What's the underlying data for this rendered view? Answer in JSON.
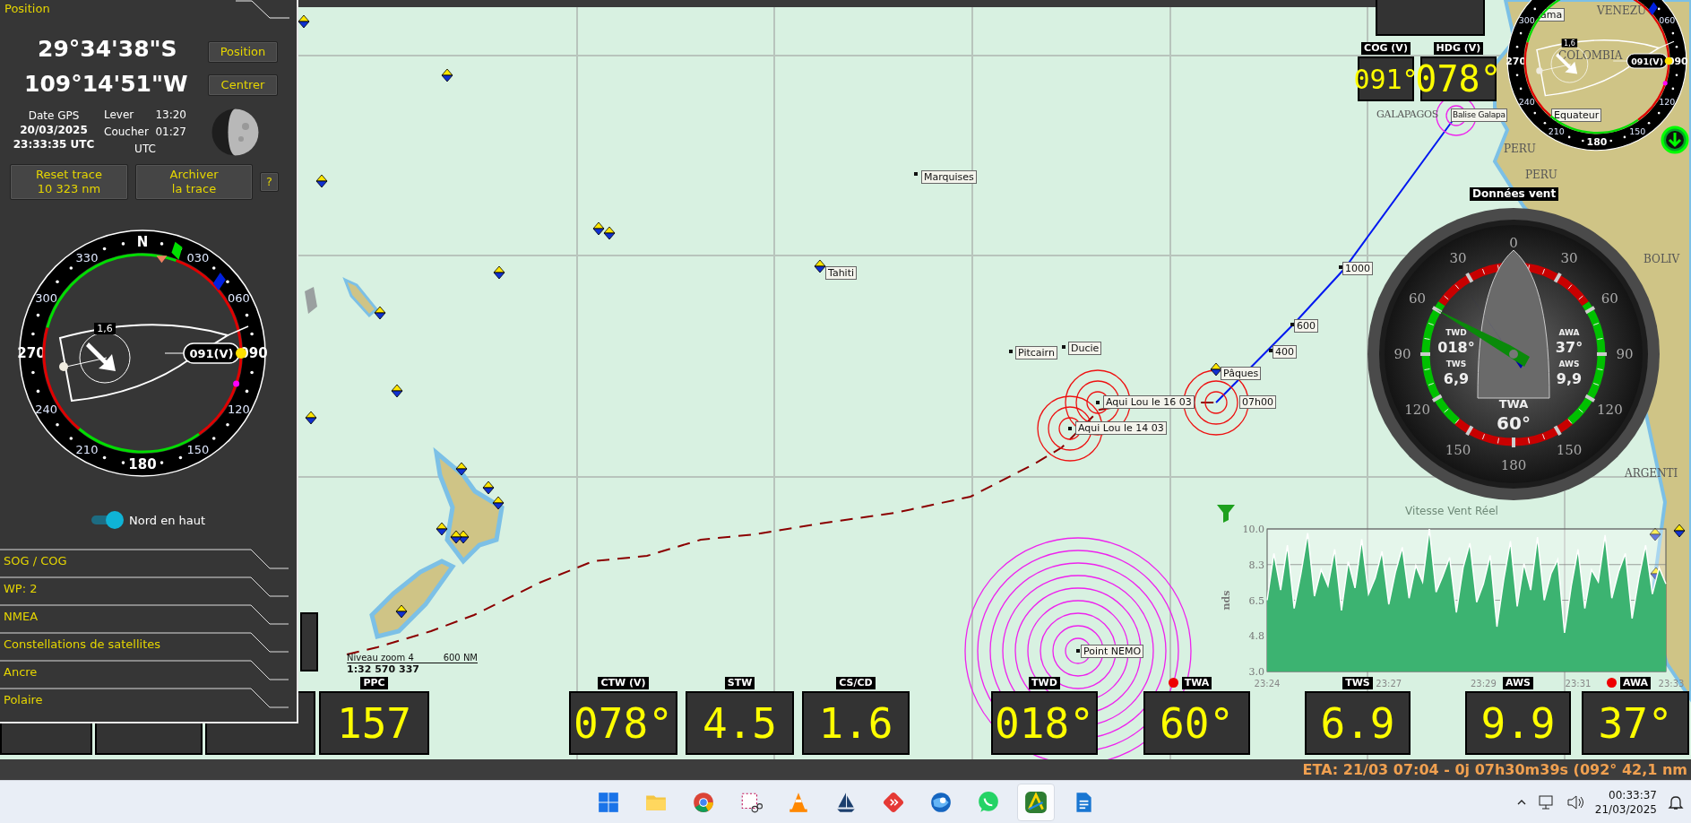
{
  "left_panel": {
    "title": "Position",
    "latitude": "29°34'38\"S",
    "longitude": "109°14'51\"W",
    "buttons": [
      "Position",
      "Centrer"
    ],
    "gps": {
      "label": "Date GPS",
      "date": "20/03/2025",
      "time": "23:33:35 UTC"
    },
    "moon": {
      "rise_label": "Lever",
      "rise": "13:20",
      "set_label": "Coucher",
      "set": "01:27",
      "zone": "UTC"
    },
    "trace_buttons": [
      {
        "label": "Reset trace",
        "detail": "10 323 nm"
      },
      {
        "label": "Archiver",
        "detail": "la trace"
      }
    ],
    "help_button": "?",
    "compass": {
      "labels": [
        "N",
        "030",
        "060",
        "090",
        "120",
        "150",
        "180",
        "210",
        "240",
        "270",
        "300",
        "330"
      ],
      "heading": "091(V)",
      "speed": "1,6"
    },
    "toggle": {
      "label": "Nord en haut",
      "on": true
    },
    "sections": [
      {
        "label": "SOG / COG"
      },
      {
        "label": "WP: 2"
      },
      {
        "label": "NMEA"
      },
      {
        "label": "Constellations de satellites"
      },
      {
        "label": "Ancre"
      },
      {
        "label": "Polaire"
      }
    ]
  },
  "map": {
    "places": [
      {
        "text": "Marquises",
        "kind": "box"
      },
      {
        "text": "Tahiti",
        "kind": "box"
      },
      {
        "text": "Pitcairn",
        "kind": "box"
      },
      {
        "text": "Ducie",
        "kind": "box"
      },
      {
        "text": "Pâques",
        "kind": "box"
      },
      {
        "text": "Aqui Lou le 16 03",
        "kind": "box"
      },
      {
        "text": "Aqui Lou le 14 03",
        "kind": "box"
      },
      {
        "text": "07h00",
        "kind": "box"
      },
      {
        "text": "1000",
        "kind": "box"
      },
      {
        "text": "600",
        "kind": "box"
      },
      {
        "text": "400",
        "kind": "box"
      },
      {
        "text": "Point NEMO",
        "kind": "box"
      },
      {
        "text": "GALAPAGOS",
        "kind": "region"
      },
      {
        "text": "Balise Galapa",
        "kind": "box"
      },
      {
        "text": "Equateur",
        "kind": "box"
      },
      {
        "text": "PERU",
        "kind": "region"
      },
      {
        "text": "PERU",
        "kind": "region"
      },
      {
        "text": "VENEZU",
        "kind": "region"
      },
      {
        "text": "COLOMBIA",
        "kind": "region"
      },
      {
        "text": "BOLIV",
        "kind": "region"
      },
      {
        "text": "ARGENTI",
        "kind": "region"
      },
      {
        "text": "ama",
        "kind": "box"
      }
    ],
    "scale": {
      "zoom": "Niveau zoom 4",
      "distance": "600 NM",
      "ratio": "1:32 570 337"
    }
  },
  "top_compass": {
    "labels": [
      "060",
      "090",
      "120",
      "150",
      "180",
      "210",
      "240",
      "270",
      "300"
    ],
    "heading": "091(V)",
    "speed": "1,6"
  },
  "top_displays": [
    {
      "label": "COG (V)",
      "value": "091°"
    },
    {
      "label": "HDG (V)",
      "value": "078°"
    }
  ],
  "bottom_displays": [
    {
      "label": "PPC",
      "value": "157"
    },
    {
      "label": "CTW (V)",
      "value": "078°"
    },
    {
      "label": "STW",
      "value": "4.5"
    },
    {
      "label": "CS/CD",
      "value": "1.6"
    },
    {
      "label": "TWD",
      "value": "018°"
    },
    {
      "label": "TWA",
      "value": "60°",
      "alarm": true
    },
    {
      "label": "TWS",
      "value": "6.9"
    },
    {
      "label": "AWS",
      "value": "9.9"
    },
    {
      "label": "AWA",
      "value": "37°",
      "alarm": true
    }
  ],
  "wind_gauge": {
    "title": "Données vent",
    "labels": [
      "0",
      "30",
      "60",
      "90",
      "120",
      "150",
      "180",
      "150",
      "120",
      "90",
      "60",
      "30"
    ],
    "readings": [
      {
        "label": "TWD",
        "value": "018°"
      },
      {
        "label": "TWS",
        "value": "6,9"
      },
      {
        "label": "AWA",
        "value": "37°"
      },
      {
        "label": "AWS",
        "value": "9,9"
      },
      {
        "label": "TWA",
        "value": "60°"
      }
    ]
  },
  "wind_chart": {
    "chart_data": {
      "type": "area",
      "title": "Vitesse Vent Réel",
      "ylabel": "nds",
      "ylim": [
        3,
        10
      ],
      "categories": [
        "23:24",
        null,
        null,
        null,
        null,
        null,
        null,
        null,
        null,
        null,
        null,
        null,
        null,
        null,
        null,
        null,
        null,
        null,
        "23:27",
        null,
        null,
        null,
        null,
        null,
        null,
        null,
        null,
        null,
        null,
        null,
        null,
        null,
        "23:29",
        null,
        null,
        null,
        null,
        null,
        null,
        null,
        null,
        null,
        null,
        null,
        null,
        null,
        "23:31",
        null,
        null,
        null,
        null,
        null,
        null,
        null,
        null,
        null,
        null,
        null,
        null,
        "23:33"
      ],
      "yticks": [
        {
          "value": 3,
          "label": "3.0"
        },
        {
          "value": 4.75,
          "label": "4.8"
        },
        {
          "value": 6.5,
          "label": "6.5"
        },
        {
          "value": 8.25,
          "label": "8.3"
        },
        {
          "value": 10,
          "label": "10.0"
        }
      ],
      "series": [
        {
          "color": "#3cb371",
          "values": [
            6.5,
            8.8,
            7.0,
            9.2,
            6.1,
            7.8,
            9.8,
            6.7,
            8.0,
            7.2,
            9.0,
            6.0,
            8.4,
            7.1,
            9.5,
            6.8,
            7.6,
            8.9,
            6.3,
            7.9,
            9.1,
            6.6,
            8.2,
            7.4,
            10.0,
            6.9,
            7.7,
            8.6,
            5.9,
            8.1,
            9.3,
            6.4,
            7.3,
            8.7,
            5.2,
            7.5,
            9.4,
            6.2,
            8.3,
            7.0,
            9.6,
            6.5,
            7.8,
            8.5,
            4.9,
            7.2,
            9.0,
            6.1,
            8.0,
            7.4,
            9.7,
            6.6,
            7.9,
            8.8,
            5.6,
            7.6,
            9.2,
            6.8,
            8.1,
            7.3
          ]
        }
      ]
    }
  },
  "eta_bar": {
    "text": "ETA: 21/03 07:04 - 0j 07h30m39s (092° 42,1 nm"
  },
  "taskbar": {
    "apps": [
      {
        "kind": "start",
        "selected": false
      },
      {
        "kind": "folder",
        "selected": false
      },
      {
        "kind": "browser",
        "selected": false
      },
      {
        "kind": "snip",
        "selected": false
      },
      {
        "kind": "cone",
        "selected": false
      },
      {
        "kind": "sailboat",
        "selected": false
      },
      {
        "kind": "diamond",
        "selected": false
      },
      {
        "kind": "globe",
        "selected": false
      },
      {
        "kind": "chat",
        "selected": false
      },
      {
        "kind": "navigation",
        "selected": true
      },
      {
        "kind": "document",
        "selected": false
      }
    ],
    "clock": {
      "time": "00:33:37",
      "date": "21/03/2025"
    }
  }
}
